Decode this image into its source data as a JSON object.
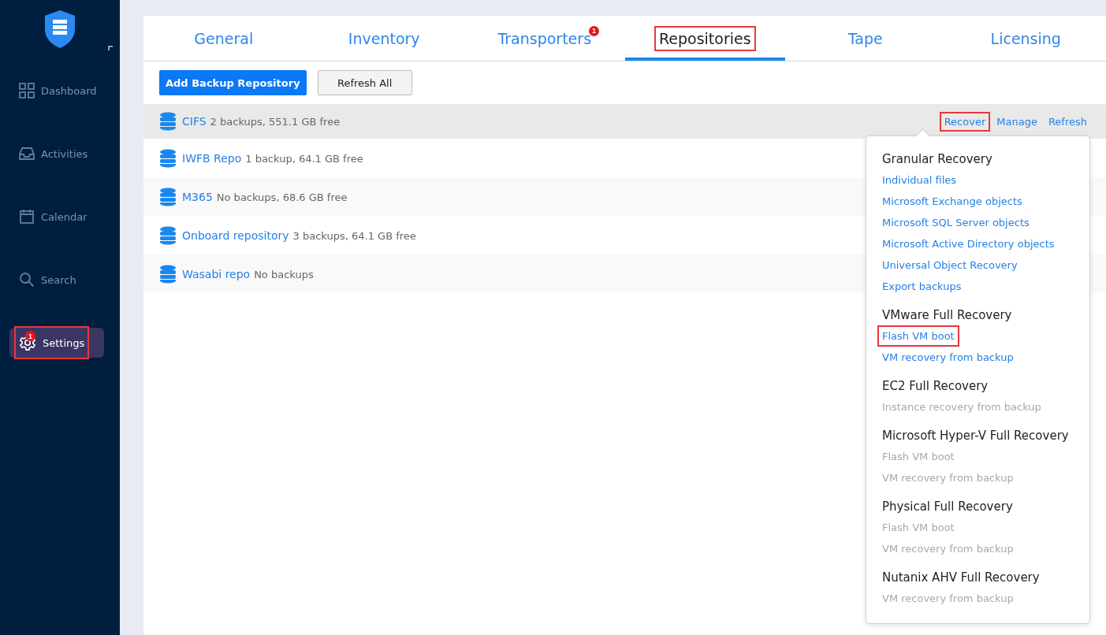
{
  "sidebar": {
    "items": [
      {
        "label": "Dashboard",
        "selected": false,
        "highlighted": false
      },
      {
        "label": "Activities",
        "selected": false,
        "highlighted": false
      },
      {
        "label": "Calendar",
        "selected": false,
        "highlighted": false
      },
      {
        "label": "Search",
        "selected": false,
        "highlighted": false
      },
      {
        "label": "Settings",
        "selected": true,
        "highlighted": true,
        "badge": "1"
      }
    ]
  },
  "tabs": [
    {
      "label": "General",
      "selected": false,
      "highlighted": false
    },
    {
      "label": "Inventory",
      "selected": false,
      "highlighted": false
    },
    {
      "label": "Transporters",
      "selected": false,
      "highlighted": false,
      "badge": "1"
    },
    {
      "label": "Repositories",
      "selected": true,
      "highlighted": true
    },
    {
      "label": "Tape",
      "selected": false,
      "highlighted": false
    },
    {
      "label": "Licensing",
      "selected": false,
      "highlighted": false
    }
  ],
  "toolbar": {
    "buttons": [
      {
        "label": "Add Backup Repository",
        "kind": "primary"
      },
      {
        "label": "Refresh All",
        "kind": "secondary"
      }
    ]
  },
  "repositories": [
    {
      "name": "CIFS",
      "details": "2 backups, 551.1 GB free",
      "selected": true,
      "actions": [
        {
          "label": "Recover",
          "highlighted": true
        },
        {
          "label": "Manage",
          "highlighted": false
        },
        {
          "label": "Refresh",
          "highlighted": false
        }
      ]
    },
    {
      "name": "IWFB Repo",
      "details": "1 backup, 64.1 GB free",
      "selected": false
    },
    {
      "name": "M365",
      "details": "No backups, 68.6 GB free",
      "selected": false
    },
    {
      "name": "Onboard repository",
      "details": "3 backups, 64.1 GB free",
      "selected": false
    },
    {
      "name": "Wasabi repo",
      "details": "No backups",
      "selected": false
    }
  ],
  "recover_menu": {
    "groups": [
      {
        "title": "Granular Recovery",
        "items": [
          {
            "label": "Individual files",
            "disabled": false,
            "highlighted": false
          },
          {
            "label": "Microsoft Exchange objects",
            "disabled": false,
            "highlighted": false
          },
          {
            "label": "Microsoft SQL Server objects",
            "disabled": false,
            "highlighted": false
          },
          {
            "label": "Microsoft Active Directory objects",
            "disabled": false,
            "highlighted": false
          },
          {
            "label": "Universal Object Recovery",
            "disabled": false,
            "highlighted": false
          },
          {
            "label": "Export backups",
            "disabled": false,
            "highlighted": false
          }
        ]
      },
      {
        "title": "VMware Full Recovery",
        "items": [
          {
            "label": "Flash VM boot",
            "disabled": false,
            "highlighted": true
          },
          {
            "label": "VM recovery from backup",
            "disabled": false,
            "highlighted": false
          }
        ]
      },
      {
        "title": "EC2 Full Recovery",
        "items": [
          {
            "label": "Instance recovery from backup",
            "disabled": true,
            "highlighted": false
          }
        ]
      },
      {
        "title": "Microsoft Hyper-V Full Recovery",
        "items": [
          {
            "label": "Flash VM boot",
            "disabled": true,
            "highlighted": false
          },
          {
            "label": "VM recovery from backup",
            "disabled": true,
            "highlighted": false
          }
        ]
      },
      {
        "title": "Physical Full Recovery",
        "items": [
          {
            "label": "Flash VM boot",
            "disabled": true,
            "highlighted": false
          },
          {
            "label": "VM recovery from backup",
            "disabled": true,
            "highlighted": false
          }
        ]
      },
      {
        "title": "Nutanix AHV Full Recovery",
        "items": [
          {
            "label": "VM recovery from backup",
            "disabled": true,
            "highlighted": false
          }
        ]
      }
    ]
  }
}
